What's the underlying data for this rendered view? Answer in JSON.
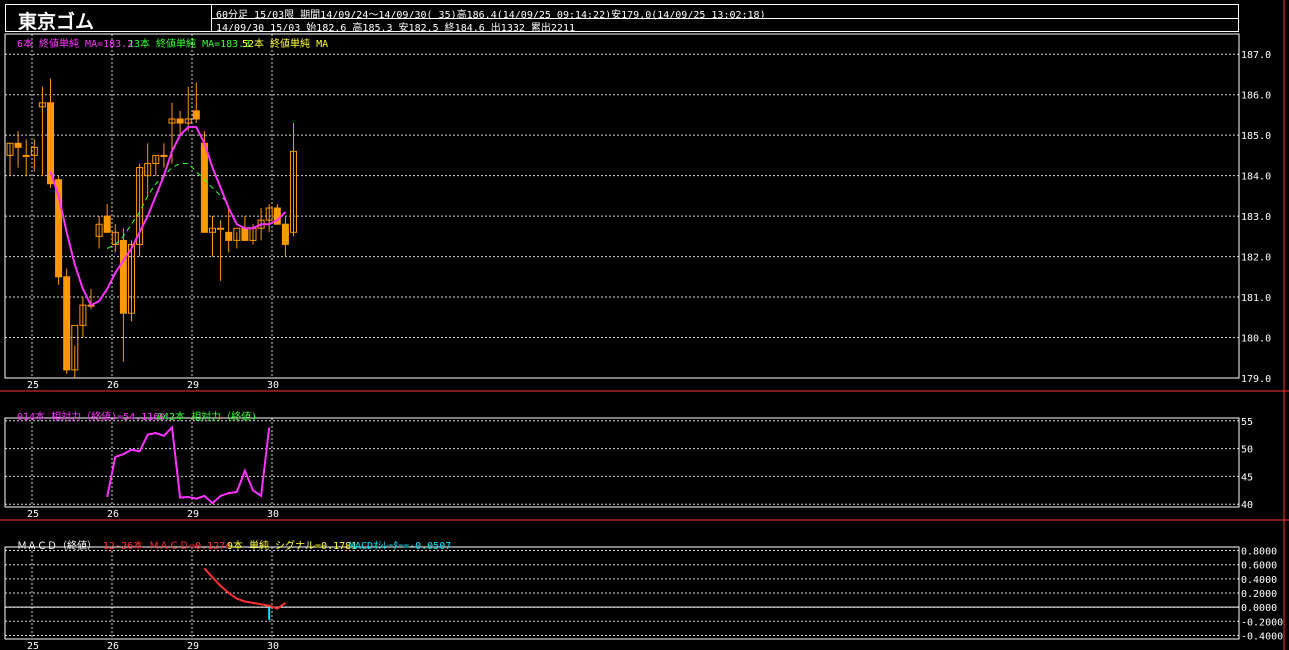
{
  "header": {
    "title": "東京ゴム",
    "info_line1": "60分足 15/03限  期間14/09/24～14/09/30( 35)高186.4(14/09/25 09:14:22)安179.0(14/09/25 13:02:18)",
    "info_line2": "14/09/30 15/03 始182.6 高185.3 安182.5 終184.6 出1332 累出2211"
  },
  "colors": {
    "candle": "#ff9900",
    "ma_short": "#ff33ff",
    "ma_mid": "#33ff33",
    "ma_long": "#ffff33",
    "rsi_line": "#ff33ff",
    "macd_line": "#ff3333",
    "signal": "#ffff33",
    "osc": "#00e5ff",
    "grid": "#ffffff",
    "border_red": "#ff3333"
  },
  "chart_data": [
    {
      "type": "candlestick",
      "legend": {
        "ma6": "6本 終値単純 MA=183.2",
        "ma13": "13本 終値単純 MA=183.3",
        "ma52": "52本 終値単純 MA"
      },
      "x_tick_labels": [
        "25",
        "26",
        "29",
        "30"
      ],
      "x_tick_index": [
        3,
        13,
        23,
        33
      ],
      "y_tick_labels": [
        "187.0",
        "186.0",
        "185.0",
        "184.0",
        "183.0",
        "182.0",
        "181.0",
        "180.0",
        "179.0"
      ],
      "ylim": [
        179.0,
        187.5
      ],
      "candles": [
        {
          "o": 184.5,
          "h": 184.8,
          "l": 184.0,
          "c": 184.8
        },
        {
          "o": 184.8,
          "h": 185.1,
          "l": 184.2,
          "c": 184.7
        },
        {
          "o": 184.5,
          "h": 184.9,
          "l": 184.0,
          "c": 184.5
        },
        {
          "o": 184.5,
          "h": 184.9,
          "l": 184.1,
          "c": 184.7
        },
        {
          "o": 185.7,
          "h": 186.2,
          "l": 184.0,
          "c": 185.8
        },
        {
          "o": 185.8,
          "h": 186.4,
          "l": 183.7,
          "c": 183.8
        },
        {
          "o": 183.9,
          "h": 184.0,
          "l": 181.3,
          "c": 181.5
        },
        {
          "o": 181.5,
          "h": 181.7,
          "l": 179.1,
          "c": 179.2
        },
        {
          "o": 179.2,
          "h": 179.8,
          "l": 179.0,
          "c": 180.3
        },
        {
          "o": 180.3,
          "h": 181.0,
          "l": 180.0,
          "c": 180.8
        },
        {
          "o": 180.8,
          "h": 181.2,
          "l": 180.7,
          "c": 180.8
        },
        {
          "o": 182.5,
          "h": 183.0,
          "l": 182.2,
          "c": 182.8
        },
        {
          "o": 183.0,
          "h": 183.3,
          "l": 182.8,
          "c": 182.6
        },
        {
          "o": 182.3,
          "h": 182.8,
          "l": 182.1,
          "c": 182.6
        },
        {
          "o": 182.4,
          "h": 182.7,
          "l": 179.4,
          "c": 180.6
        },
        {
          "o": 180.6,
          "h": 182.4,
          "l": 180.4,
          "c": 182.3
        },
        {
          "o": 182.3,
          "h": 184.3,
          "l": 182.0,
          "c": 184.2
        },
        {
          "o": 184.0,
          "h": 184.8,
          "l": 183.5,
          "c": 184.3
        },
        {
          "o": 184.3,
          "h": 184.5,
          "l": 184.0,
          "c": 184.5
        },
        {
          "o": 184.5,
          "h": 184.8,
          "l": 184.2,
          "c": 184.5
        },
        {
          "o": 185.3,
          "h": 185.8,
          "l": 184.3,
          "c": 185.4
        },
        {
          "o": 185.4,
          "h": 185.6,
          "l": 185.0,
          "c": 185.3
        },
        {
          "o": 185.3,
          "h": 186.2,
          "l": 185.1,
          "c": 185.4
        },
        {
          "o": 185.6,
          "h": 186.3,
          "l": 185.3,
          "c": 185.4
        },
        {
          "o": 184.8,
          "h": 185.1,
          "l": 182.6,
          "c": 182.6
        },
        {
          "o": 182.6,
          "h": 183.0,
          "l": 182.0,
          "c": 182.7
        },
        {
          "o": 182.7,
          "h": 182.9,
          "l": 181.4,
          "c": 182.7
        },
        {
          "o": 182.6,
          "h": 183.2,
          "l": 182.1,
          "c": 182.4
        },
        {
          "o": 182.4,
          "h": 182.6,
          "l": 182.2,
          "c": 182.7
        },
        {
          "o": 182.7,
          "h": 183.0,
          "l": 182.4,
          "c": 182.4
        },
        {
          "o": 182.4,
          "h": 182.8,
          "l": 182.3,
          "c": 182.7
        },
        {
          "o": 182.7,
          "h": 183.2,
          "l": 182.4,
          "c": 182.9
        },
        {
          "o": 182.9,
          "h": 183.3,
          "l": 182.6,
          "c": 183.2
        },
        {
          "o": 183.2,
          "h": 183.3,
          "l": 182.8,
          "c": 182.8
        },
        {
          "o": 182.8,
          "h": 183.0,
          "l": 182.0,
          "c": 182.3
        },
        {
          "o": 182.6,
          "h": 185.3,
          "l": 182.5,
          "c": 184.6
        }
      ],
      "ma6": [
        null,
        null,
        null,
        null,
        null,
        184.1,
        183.5,
        182.6,
        181.8,
        181.2,
        180.8,
        180.9,
        181.2,
        181.6,
        181.9,
        182.2,
        182.6,
        183.0,
        183.5,
        184.0,
        184.6,
        185.0,
        185.2,
        185.2,
        184.8,
        184.2,
        183.7,
        183.2,
        182.8,
        182.7,
        182.7,
        182.8,
        182.8,
        182.9,
        183.1,
        null
      ],
      "ma13": [
        null,
        null,
        null,
        null,
        null,
        null,
        null,
        null,
        null,
        null,
        null,
        null,
        182.2,
        182.3,
        182.5,
        182.8,
        183.1,
        183.5,
        183.8,
        184.0,
        184.2,
        184.3,
        184.3,
        184.1,
        183.9,
        183.7,
        183.5,
        183.3,
        null,
        null,
        null,
        null,
        null,
        null,
        null,
        null
      ]
    },
    {
      "type": "line",
      "legend": {
        "rsi14": "014本 相対力（終値)=54.1160",
        "rsi42": "042本 相対力（終値)"
      },
      "x_tick_labels": [
        "25",
        "26",
        "29",
        "30"
      ],
      "y_tick_labels": [
        "55",
        "50",
        "45",
        "40"
      ],
      "ylim": [
        39.5,
        55.5
      ],
      "values": [
        null,
        null,
        null,
        null,
        null,
        null,
        null,
        null,
        null,
        null,
        null,
        null,
        41.3,
        48.5,
        49.0,
        49.8,
        49.5,
        52.5,
        52.8,
        52.3,
        53.8,
        41.2,
        41.3,
        41.0,
        41.5,
        40.2,
        41.5,
        42.0,
        42.2,
        46.0,
        42.5,
        41.5,
        53.8,
        null,
        null,
        null
      ],
      "values_index_offset": 0
    },
    {
      "type": "line",
      "legend": {
        "title": "ＭＡＣＤ（終値）",
        "macd": "12-26本 ＭＡＣＤ=0.1274",
        "signal": "9本 単純 シグナル=0.1781",
        "osc": "MACDｵｼﾚｰﾀｰ=-0.0507"
      },
      "x_tick_labels": [
        "25",
        "26",
        "29",
        "30"
      ],
      "y_tick_labels": [
        "0.8000",
        "0.6000",
        "0.4000",
        "0.2000",
        "0.0000",
        "-0.2000",
        "-0.4000"
      ],
      "ylim": [
        -0.45,
        0.85
      ],
      "macd": [
        null,
        null,
        null,
        null,
        null,
        null,
        null,
        null,
        null,
        null,
        null,
        null,
        null,
        null,
        null,
        null,
        null,
        null,
        null,
        null,
        null,
        null,
        null,
        null,
        0.55,
        0.42,
        0.3,
        0.2,
        0.12,
        0.08,
        0.06,
        0.04,
        0.02,
        -0.02,
        0.06,
        null
      ],
      "osc": [
        null,
        null,
        null,
        null,
        null,
        null,
        null,
        null,
        null,
        null,
        null,
        null,
        null,
        null,
        null,
        null,
        null,
        null,
        null,
        null,
        null,
        null,
        null,
        null,
        null,
        null,
        null,
        null,
        null,
        null,
        null,
        null,
        -0.18,
        0.0,
        null,
        null
      ]
    }
  ]
}
